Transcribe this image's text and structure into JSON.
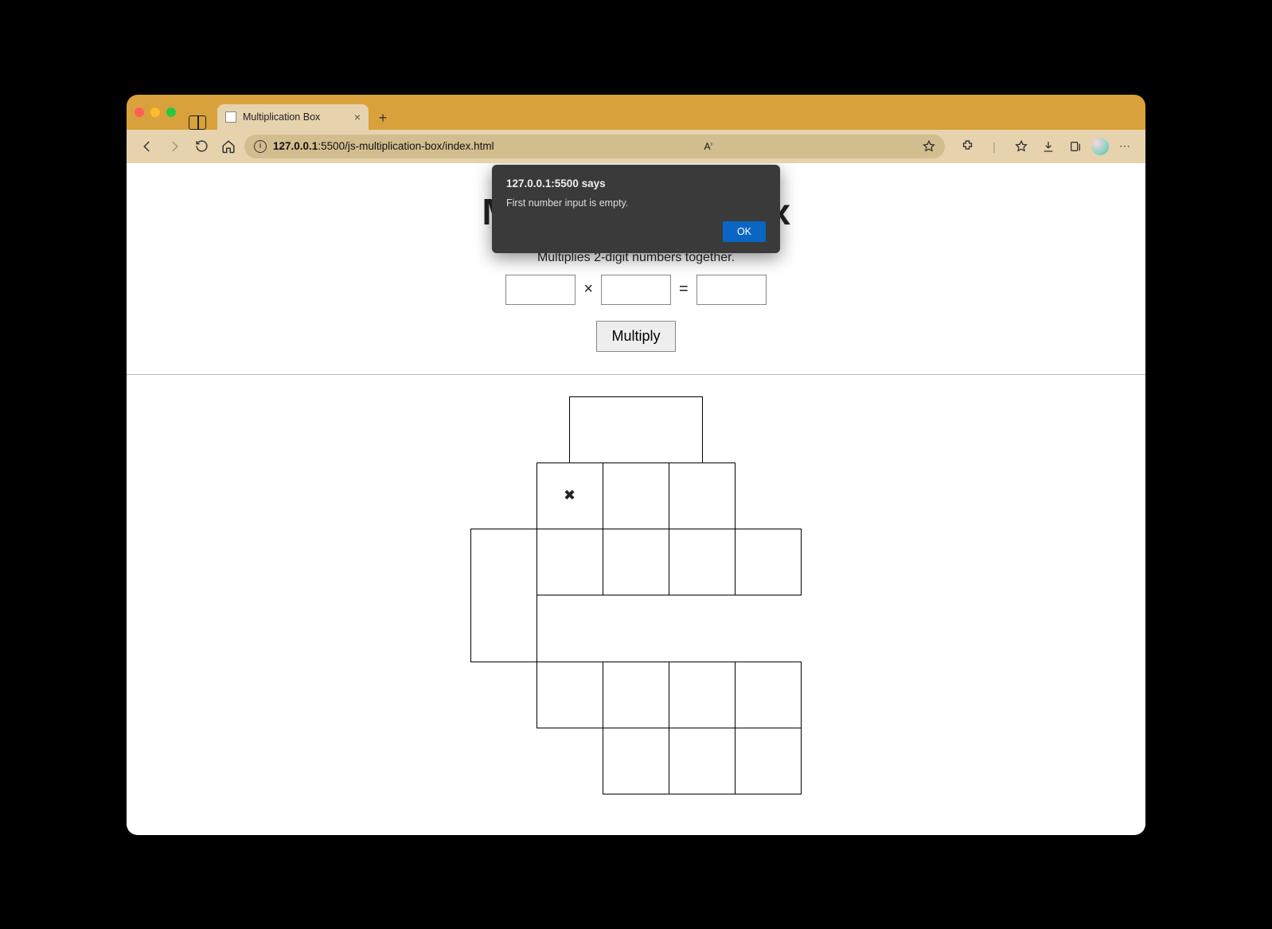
{
  "browser": {
    "tab_title": "Multiplication Box",
    "url_display": "127.0.0.1:5500/js-multiplication-box/index.html",
    "url_bold_prefix": "127.0.0.1"
  },
  "alert": {
    "title": "127.0.0.1:5500 says",
    "message": "First number input is empty.",
    "ok_label": "OK"
  },
  "page": {
    "heading": "Multiplication Box",
    "subheading": "Multiplies 2-digit numbers together.",
    "times_symbol": "×",
    "equals_symbol": "=",
    "multiply_button": "Multiply",
    "input1_value": "",
    "input2_value": "",
    "result_value": "",
    "box_times": "✖"
  }
}
